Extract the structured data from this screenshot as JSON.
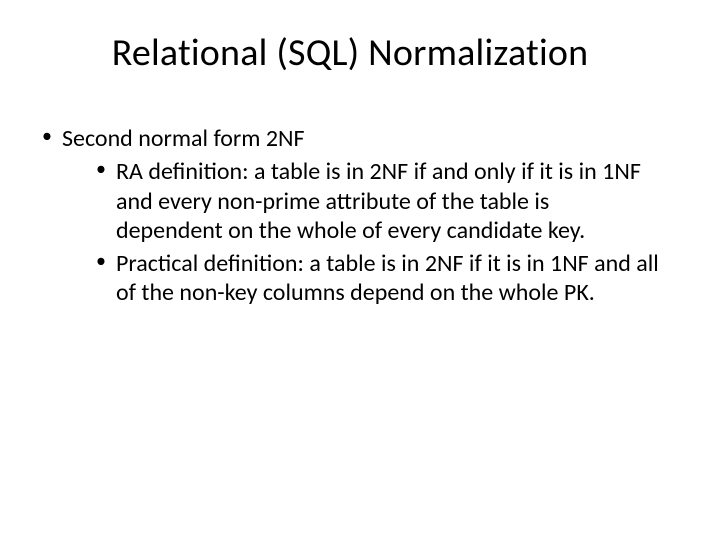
{
  "slide": {
    "title": "Relational (SQL) Normalization",
    "bullets": {
      "item1": {
        "text": "Second normal form 2NF",
        "children": {
          "c1": "RA definition: a table is in 2NF if and only if it is in 1NF and every non-prime attribute of the table is dependent on the whole of every candidate key.",
          "c2": "Practical definition: a table is in 2NF if it is in 1NF and all of the non-key columns depend on the whole PK."
        }
      }
    }
  }
}
